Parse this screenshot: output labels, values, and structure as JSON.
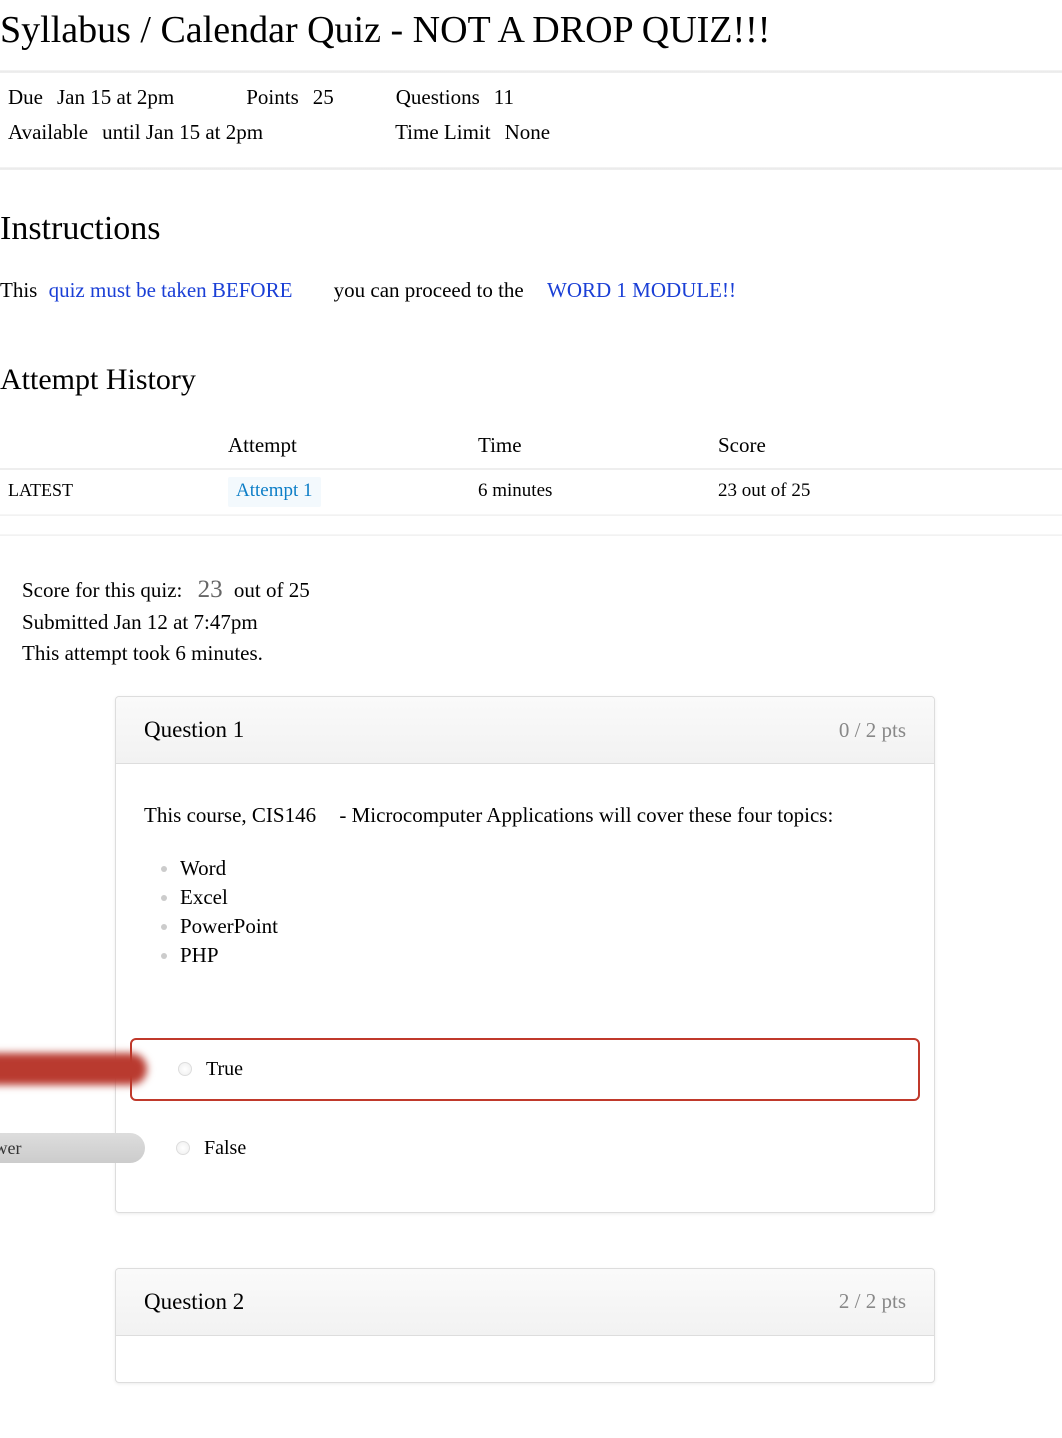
{
  "title": "Syllabus / Calendar Quiz - NOT A DROP QUIZ!!!",
  "meta": {
    "due_label": "Due",
    "due_value": "Jan 15 at 2pm",
    "points_label": "Points",
    "points_value": "25",
    "questions_label": "Questions",
    "questions_value": "11",
    "available_label": "Available",
    "available_value": "until Jan 15 at 2pm",
    "timelimit_label": "Time Limit",
    "timelimit_value": "None"
  },
  "instructions": {
    "heading": "Instructions",
    "part1": "This",
    "blue1": "quiz must be taken BEFORE",
    "part2": "you can proceed to the",
    "blue2": "WORD 1 MODULE!!"
  },
  "attempt": {
    "heading": "Attempt History",
    "col_attempt": "Attempt",
    "col_time": "Time",
    "col_score": "Score",
    "row": {
      "status": "LATEST",
      "attempt": "Attempt 1",
      "time": "6 minutes",
      "score": "23 out of 25"
    }
  },
  "score": {
    "label": "Score for this quiz:",
    "value": "23",
    "suffix": "out of 25",
    "submitted": "Submitted Jan 12 at 7:47pm",
    "duration": "This attempt took 6 minutes."
  },
  "q1": {
    "title": "Question 1",
    "pts": "0 / 2 pts",
    "text1": "This course, CIS146",
    "text2": "- Microcomputer Applications will cover these four topics:",
    "topics": {
      "a": "Word",
      "b": "Excel",
      "c": "PowerPoint",
      "d": "PHP"
    },
    "ans_true": "True",
    "ans_false": "False",
    "correct_label": "orrect Answer"
  },
  "q2": {
    "title": "Question 2",
    "pts": "2 / 2 pts"
  }
}
